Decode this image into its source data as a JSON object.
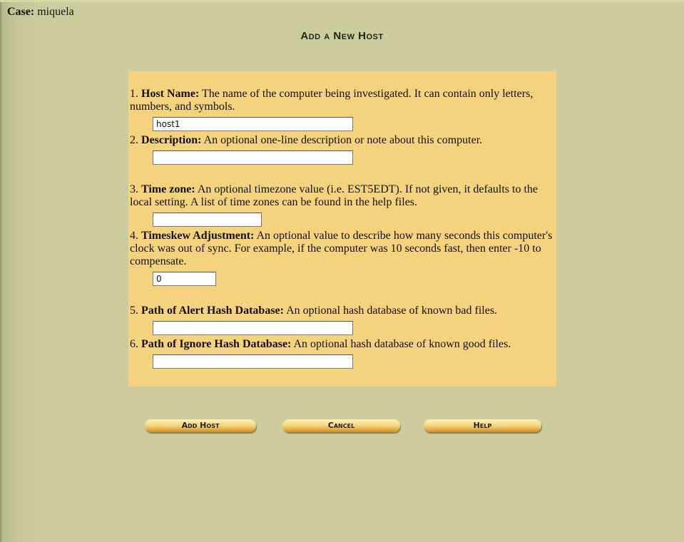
{
  "case": {
    "label": "Case:",
    "value": "miquela"
  },
  "page_title": "Add a New Host",
  "fields": [
    {
      "num": "1.",
      "label": "Host Name:",
      "desc": "The name of the computer being investigated. It can contain only letters, numbers, and symbols.",
      "value": "host1"
    },
    {
      "num": "2.",
      "label": "Description:",
      "desc": "An optional one-line description or note about this computer.",
      "value": ""
    },
    {
      "num": "3.",
      "label": "Time zone:",
      "desc": "An optional timezone value (i.e. EST5EDT). If not given, it defaults to the local setting. A list of time zones can be found in the help files.",
      "value": ""
    },
    {
      "num": "4.",
      "label": "Timeskew Adjustment:",
      "desc": "An optional value to describe how many seconds this computer's clock was out of sync. For example, if the computer was 10 seconds fast, then enter -10 to compensate.",
      "value": "0"
    },
    {
      "num": "5.",
      "label": "Path of Alert Hash Database:",
      "desc": "An optional hash database of known bad files.",
      "value": ""
    },
    {
      "num": "6.",
      "label": "Path of Ignore Hash Database:",
      "desc": "An optional hash database of known good files.",
      "value": ""
    }
  ],
  "buttons": {
    "add": "Add Host",
    "cancel": "Cancel",
    "help": "Help"
  },
  "colors": {
    "background": "#cccc9c",
    "panel": "#f4d27e",
    "button": "#f6d884"
  }
}
